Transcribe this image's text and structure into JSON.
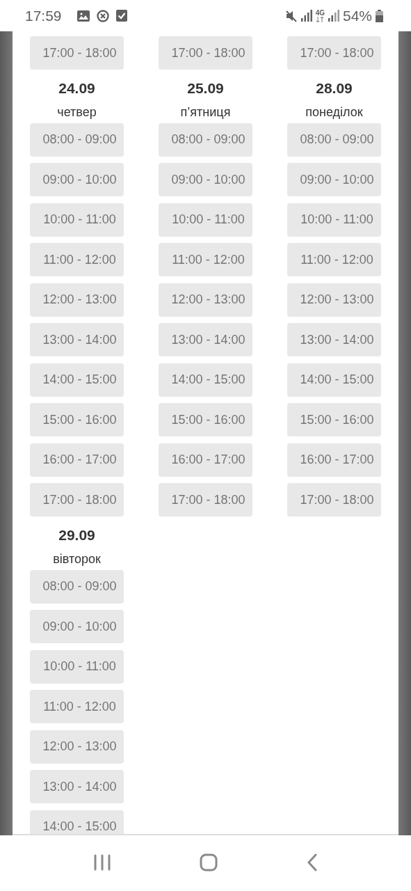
{
  "status_bar": {
    "time": "17:59",
    "network": "4G",
    "battery": "54%"
  },
  "days": [
    {
      "slots": [
        "17:00 - 18:00"
      ]
    },
    {
      "slots": [
        "17:00 - 18:00"
      ]
    },
    {
      "slots": [
        "17:00 - 18:00"
      ]
    },
    {
      "date": "24.09",
      "weekday": "четвер",
      "slots": [
        "08:00 - 09:00",
        "09:00 - 10:00",
        "10:00 - 11:00",
        "11:00 - 12:00",
        "12:00 - 13:00",
        "13:00 - 14:00",
        "14:00 - 15:00",
        "15:00 - 16:00",
        "16:00 - 17:00",
        "17:00 - 18:00"
      ]
    },
    {
      "date": "25.09",
      "weekday": "п’ятниця",
      "slots": [
        "08:00 - 09:00",
        "09:00 - 10:00",
        "10:00 - 11:00",
        "11:00 - 12:00",
        "12:00 - 13:00",
        "13:00 - 14:00",
        "14:00 - 15:00",
        "15:00 - 16:00",
        "16:00 - 17:00",
        "17:00 - 18:00"
      ]
    },
    {
      "date": "28.09",
      "weekday": "понеділок",
      "slots": [
        "08:00 - 09:00",
        "09:00 - 10:00",
        "10:00 - 11:00",
        "11:00 - 12:00",
        "12:00 - 13:00",
        "13:00 - 14:00",
        "14:00 - 15:00",
        "15:00 - 16:00",
        "16:00 - 17:00",
        "17:00 - 18:00"
      ]
    },
    {
      "date": "29.09",
      "weekday": "вівторок",
      "slots": [
        "08:00 - 09:00",
        "09:00 - 10:00",
        "10:00 - 11:00",
        "11:00 - 12:00",
        "12:00 - 13:00",
        "13:00 - 14:00",
        "14:00 - 15:00"
      ]
    }
  ]
}
